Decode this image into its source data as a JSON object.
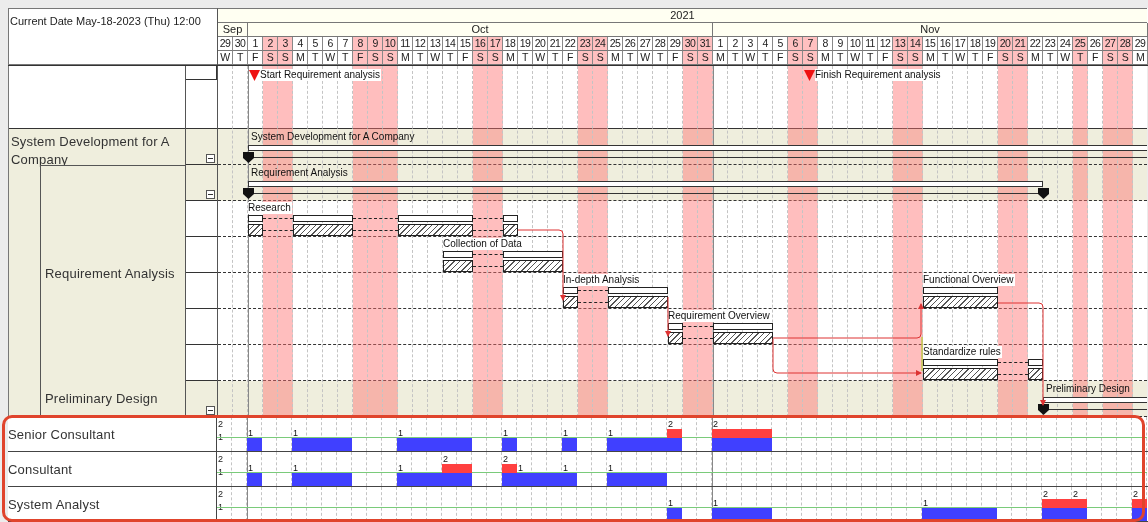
{
  "header": {
    "current_date": "Current Date May-18-2023 (Thu) 12:00",
    "year": "2021",
    "months": [
      {
        "label": "Sep",
        "days": [
          {
            "date": "29",
            "weekday": "W",
            "off": false
          },
          {
            "date": "30",
            "weekday": "T",
            "off": false
          }
        ]
      },
      {
        "label": "Oct",
        "days": [
          {
            "date": "1",
            "weekday": "F",
            "off": false
          },
          {
            "date": "2",
            "weekday": "S",
            "off": true
          },
          {
            "date": "3",
            "weekday": "S",
            "off": true
          },
          {
            "date": "4",
            "weekday": "M",
            "off": false
          },
          {
            "date": "5",
            "weekday": "T",
            "off": false
          },
          {
            "date": "6",
            "weekday": "W",
            "off": false
          },
          {
            "date": "7",
            "weekday": "T",
            "off": false
          },
          {
            "date": "8",
            "weekday": "F",
            "off": true
          },
          {
            "date": "9",
            "weekday": "S",
            "off": true
          },
          {
            "date": "10",
            "weekday": "S",
            "off": true
          },
          {
            "date": "11",
            "weekday": "M",
            "off": false
          },
          {
            "date": "12",
            "weekday": "T",
            "off": false
          },
          {
            "date": "13",
            "weekday": "W",
            "off": false
          },
          {
            "date": "14",
            "weekday": "T",
            "off": false
          },
          {
            "date": "15",
            "weekday": "F",
            "off": false
          },
          {
            "date": "16",
            "weekday": "S",
            "off": true
          },
          {
            "date": "17",
            "weekday": "S",
            "off": true
          },
          {
            "date": "18",
            "weekday": "M",
            "off": false
          },
          {
            "date": "19",
            "weekday": "T",
            "off": false
          },
          {
            "date": "20",
            "weekday": "W",
            "off": false
          },
          {
            "date": "21",
            "weekday": "T",
            "off": false
          },
          {
            "date": "22",
            "weekday": "F",
            "off": false
          },
          {
            "date": "23",
            "weekday": "S",
            "off": true
          },
          {
            "date": "24",
            "weekday": "S",
            "off": true
          },
          {
            "date": "25",
            "weekday": "M",
            "off": false
          },
          {
            "date": "26",
            "weekday": "T",
            "off": false
          },
          {
            "date": "27",
            "weekday": "W",
            "off": false
          },
          {
            "date": "28",
            "weekday": "T",
            "off": false
          },
          {
            "date": "29",
            "weekday": "F",
            "off": false
          },
          {
            "date": "30",
            "weekday": "S",
            "off": true
          },
          {
            "date": "31",
            "weekday": "S",
            "off": true
          }
        ]
      },
      {
        "label": "Nov",
        "days": [
          {
            "date": "1",
            "weekday": "M",
            "off": false
          },
          {
            "date": "2",
            "weekday": "T",
            "off": false
          },
          {
            "date": "3",
            "weekday": "W",
            "off": false
          },
          {
            "date": "4",
            "weekday": "T",
            "off": false
          },
          {
            "date": "5",
            "weekday": "F",
            "off": false
          },
          {
            "date": "6",
            "weekday": "S",
            "off": true
          },
          {
            "date": "7",
            "weekday": "S",
            "off": true
          },
          {
            "date": "8",
            "weekday": "M",
            "off": false
          },
          {
            "date": "9",
            "weekday": "T",
            "off": false
          },
          {
            "date": "10",
            "weekday": "W",
            "off": false
          },
          {
            "date": "11",
            "weekday": "T",
            "off": false
          },
          {
            "date": "12",
            "weekday": "F",
            "off": false
          },
          {
            "date": "13",
            "weekday": "S",
            "off": true
          },
          {
            "date": "14",
            "weekday": "S",
            "off": true
          },
          {
            "date": "15",
            "weekday": "M",
            "off": false
          },
          {
            "date": "16",
            "weekday": "T",
            "off": false
          },
          {
            "date": "17",
            "weekday": "W",
            "off": false
          },
          {
            "date": "18",
            "weekday": "T",
            "off": false
          },
          {
            "date": "19",
            "weekday": "F",
            "off": false
          },
          {
            "date": "20",
            "weekday": "S",
            "off": true
          },
          {
            "date": "21",
            "weekday": "S",
            "off": true
          },
          {
            "date": "22",
            "weekday": "M",
            "off": false
          },
          {
            "date": "23",
            "weekday": "T",
            "off": false
          },
          {
            "date": "24",
            "weekday": "W",
            "off": false
          },
          {
            "date": "25",
            "weekday": "T",
            "off": true
          },
          {
            "date": "26",
            "weekday": "F",
            "off": false
          },
          {
            "date": "27",
            "weekday": "S",
            "off": true
          },
          {
            "date": "28",
            "weekday": "S",
            "off": true
          },
          {
            "date": "29",
            "weekday": "M",
            "off": false
          }
        ]
      }
    ]
  },
  "milestones": [
    {
      "label": "Start Requirement analysis"
    },
    {
      "label": "Finish Requirement analysis"
    }
  ],
  "tree": [
    {
      "label": "System Development for A Company",
      "children": [
        {
          "label": "Requirement Analysis"
        },
        {
          "label": "Preliminary Design"
        }
      ]
    }
  ],
  "rows": [
    {
      "kind": "summary",
      "label": "System Development for A Company",
      "expanded": true
    },
    {
      "kind": "summary",
      "label": "Requirement Analysis",
      "expanded": true
    },
    {
      "kind": "task",
      "tasks": [
        {
          "label": "Research"
        }
      ]
    },
    {
      "kind": "task",
      "tasks": [
        {
          "label": "Collection of Data"
        }
      ]
    },
    {
      "kind": "task",
      "tasks": [
        {
          "label": "In-depth Analysis"
        },
        {
          "label": "Functional Overview"
        }
      ]
    },
    {
      "kind": "task",
      "tasks": [
        {
          "label": "Requirement Overview"
        }
      ]
    },
    {
      "kind": "task",
      "tasks": [
        {
          "label": "Standardize rules"
        }
      ]
    },
    {
      "kind": "summary",
      "label": "Preliminary Design",
      "expanded": true
    }
  ],
  "resources": [
    {
      "name": "Senior Consultant",
      "scale": [
        "2",
        "1"
      ],
      "loads": [
        {
          "value": "1",
          "overloaded": false
        },
        {
          "value": "1",
          "overloaded": false
        },
        {
          "value": "1",
          "overloaded": false
        },
        {
          "value": "1",
          "overloaded": false
        },
        {
          "value": "1",
          "overloaded": false
        },
        {
          "value": "1",
          "overloaded": false
        },
        {
          "value": "2",
          "overloaded": true
        },
        {
          "value": "2",
          "overloaded": true
        }
      ]
    },
    {
      "name": "Consultant",
      "scale": [
        "2",
        "1"
      ],
      "loads": [
        {
          "value": "1",
          "overloaded": false
        },
        {
          "value": "1",
          "overloaded": false
        },
        {
          "value": "1",
          "overloaded": false
        },
        {
          "value": "2",
          "overloaded": true
        },
        {
          "value": "2",
          "overloaded": true
        },
        {
          "value": "1",
          "overloaded": false
        },
        {
          "value": "1",
          "overloaded": false
        },
        {
          "value": "1",
          "overloaded": false
        }
      ]
    },
    {
      "name": "System Analyst",
      "scale": [
        "2",
        "1"
      ],
      "loads": [
        {
          "value": "1",
          "overloaded": false
        },
        {
          "value": "1",
          "overloaded": false
        },
        {
          "value": "1",
          "overloaded": false
        },
        {
          "value": "2",
          "overloaded": true
        },
        {
          "value": "2",
          "overloaded": true
        },
        {
          "value": "2",
          "overloaded": true
        }
      ]
    }
  ]
}
